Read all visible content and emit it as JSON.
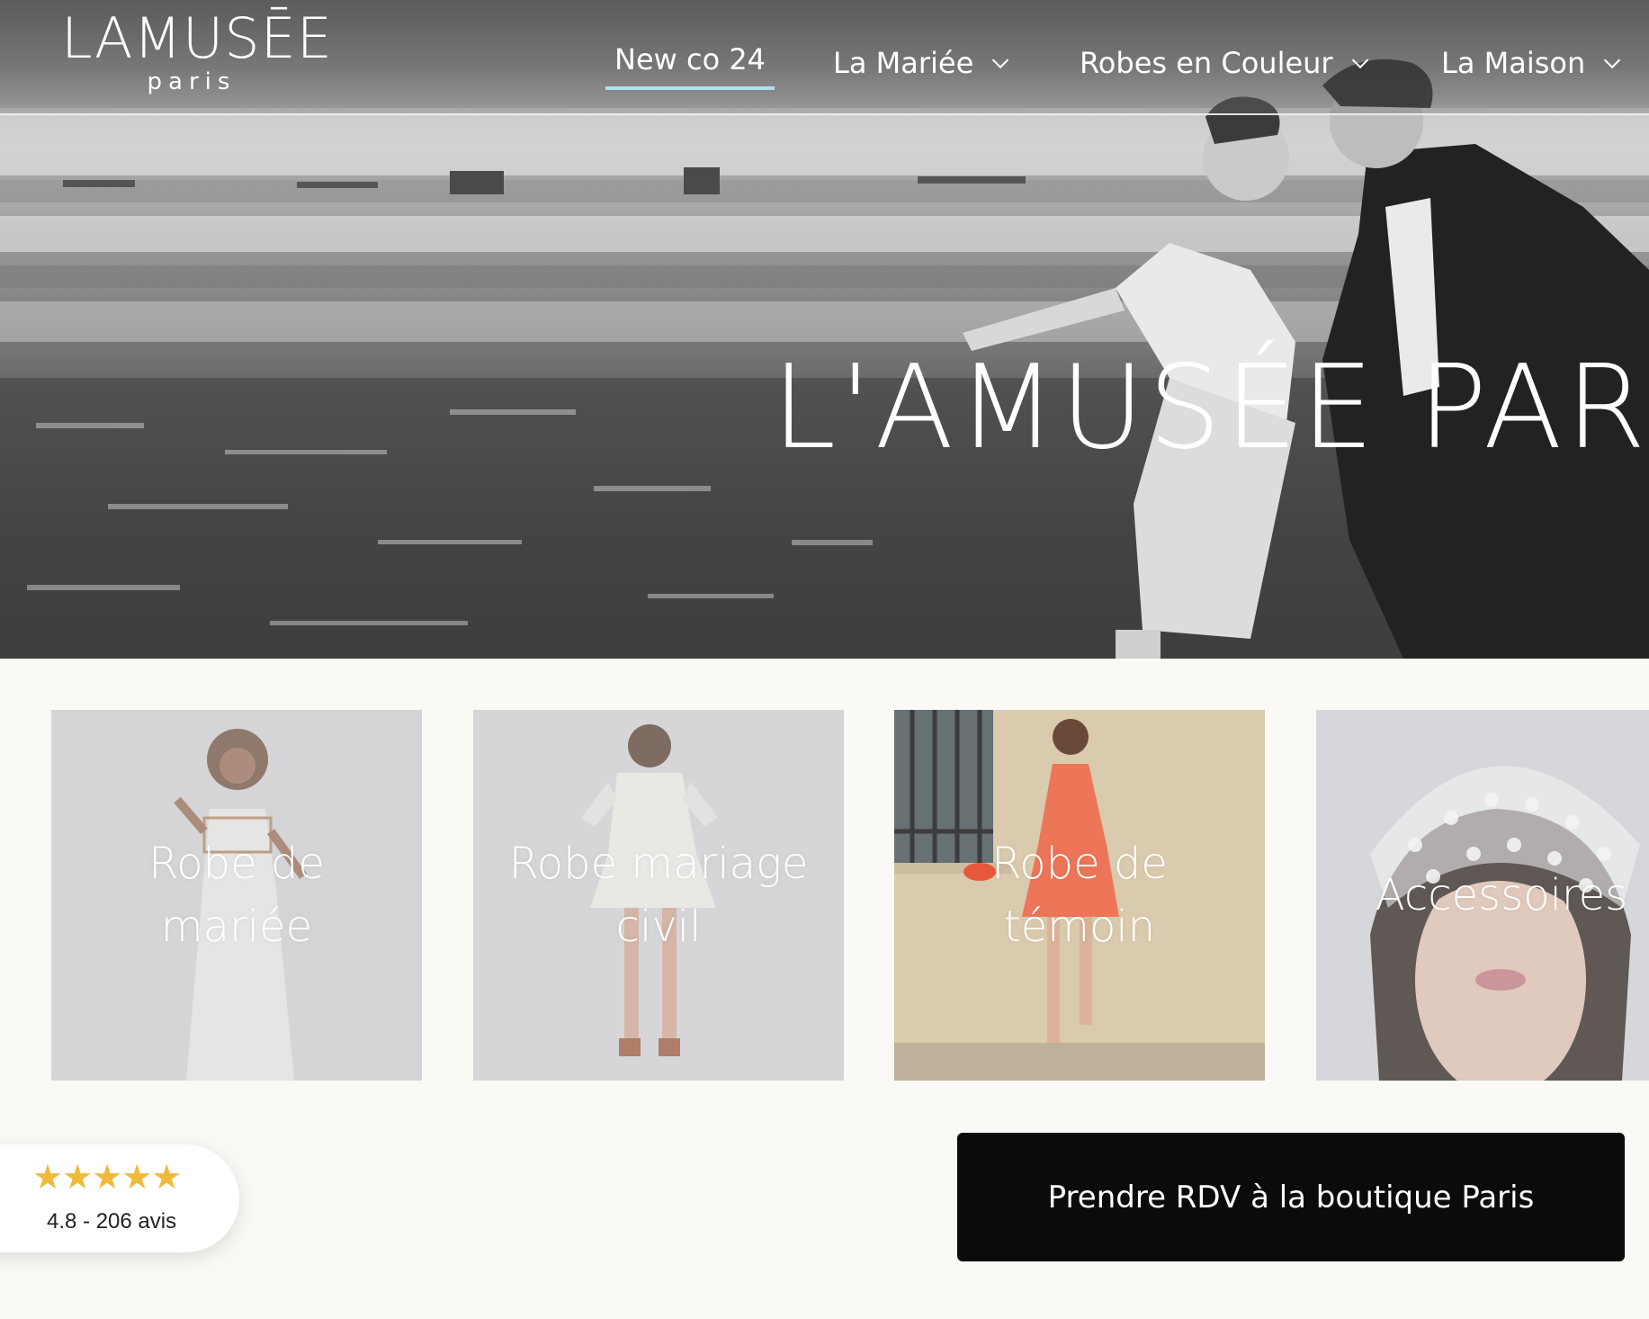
{
  "header": {
    "logo_main": "LAMUSĒE",
    "logo_sub": "paris",
    "nav": [
      {
        "label": "New co 24",
        "active": true
      },
      {
        "label": "La Mariée",
        "has_dropdown": true
      },
      {
        "label": "Robes en Couleur",
        "has_dropdown": true
      },
      {
        "label": "La Maison",
        "has_dropdown": true
      }
    ],
    "active_underline_color": "#aee0f0"
  },
  "hero": {
    "title": "L'AMUSÉE PAR"
  },
  "categories": [
    {
      "label": "Robe de mariée",
      "icon": "photo-bride-white-dress"
    },
    {
      "label": "Robe mariage civil",
      "icon": "photo-short-white-dress-back"
    },
    {
      "label": "Robe de témoin",
      "icon": "photo-orange-dress"
    },
    {
      "label": "Accessoires",
      "icon": "photo-polka-dot-veil"
    }
  ],
  "review": {
    "stars": "★★★★★",
    "text": "4.8 - 206 avis",
    "star_color": "#f1b93a"
  },
  "cta": {
    "label": "Prendre RDV à la boutique Paris"
  },
  "colors": {
    "page_background": "#faf9f5",
    "cta_background": "#0b0b0b"
  }
}
